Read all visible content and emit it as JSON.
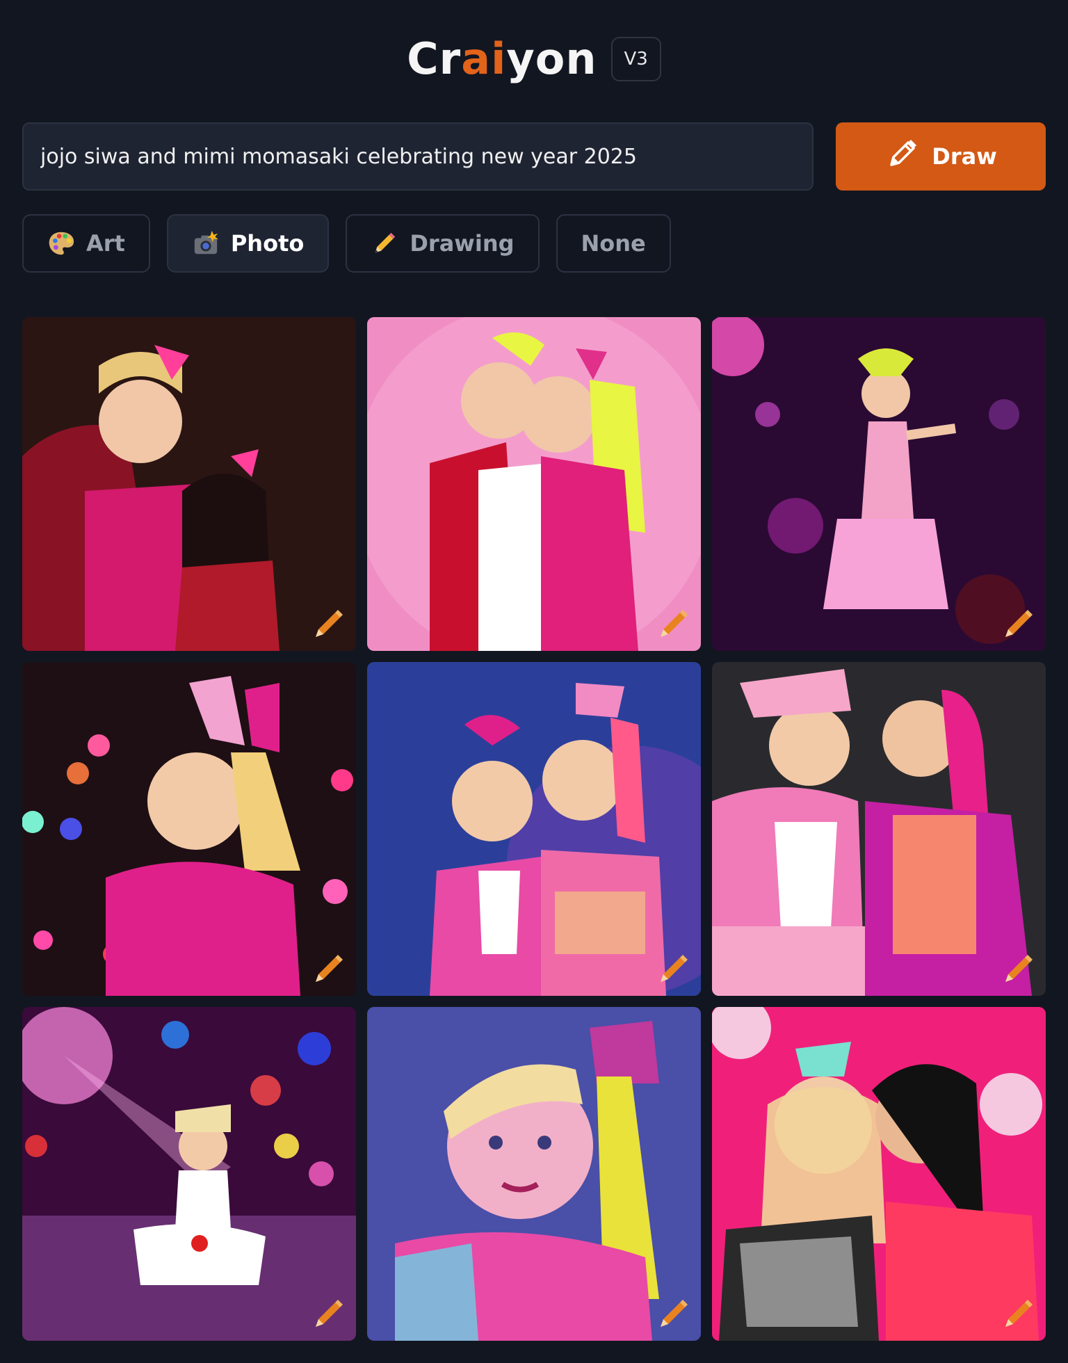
{
  "header": {
    "logo_parts": [
      "Cr",
      "ai",
      "yon"
    ],
    "version": "V3"
  },
  "prompt": {
    "value": "jojo siwa and mimi momasaki celebrating new year 2025",
    "button_label": "Draw"
  },
  "styles": [
    {
      "label": "Art",
      "icon": "palette-icon",
      "active": false
    },
    {
      "label": "Photo",
      "icon": "camera-flash-icon",
      "active": true
    },
    {
      "label": "Drawing",
      "icon": "pencil-icon",
      "active": false
    },
    {
      "label": "None",
      "icon": "",
      "active": false
    }
  ],
  "colors": {
    "background": "#121620",
    "accent": "#d35915",
    "panel": "#1f2433",
    "border": "#2c3242"
  },
  "results": [
    {
      "icon": "edit-pencil-icon",
      "palette": [
        "#2a1512",
        "#7a1020",
        "#ff3f9a"
      ]
    },
    {
      "icon": "edit-pencil-icon",
      "palette": [
        "#f08ec4",
        "#c8102e",
        "#e8f542"
      ]
    },
    {
      "icon": "edit-pencil-icon",
      "palette": [
        "#2a0a33",
        "#a4239c",
        "#f7a3d8"
      ]
    },
    {
      "icon": "edit-pencil-icon",
      "palette": [
        "#1e0f14",
        "#e0208a",
        "#f2cf7a"
      ]
    },
    {
      "icon": "edit-pencil-icon",
      "palette": [
        "#2b3f9a",
        "#e84aa6",
        "#f4d27a"
      ]
    },
    {
      "icon": "edit-pencil-icon",
      "palette": [
        "#2a2a2e",
        "#e83ba0",
        "#f6a6c9"
      ]
    },
    {
      "icon": "edit-pencil-icon",
      "palette": [
        "#3a0a3a",
        "#c51fa3",
        "#ffffff"
      ]
    },
    {
      "icon": "edit-pencil-icon",
      "palette": [
        "#4a4fa8",
        "#c0399c",
        "#e9e23a"
      ]
    },
    {
      "icon": "edit-pencil-icon",
      "palette": [
        "#f0207a",
        "#ff3a60",
        "#f2d49a"
      ]
    }
  ]
}
